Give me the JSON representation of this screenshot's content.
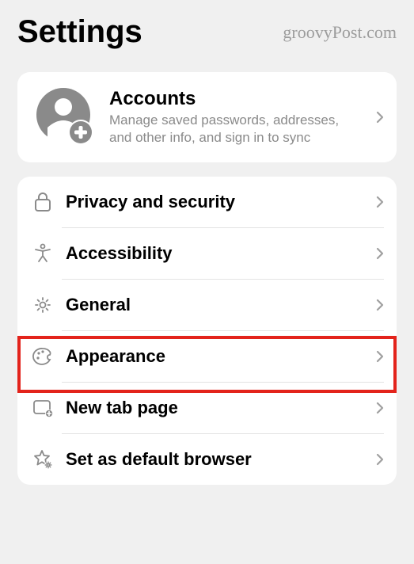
{
  "header": {
    "title": "Settings",
    "watermark": "groovyPost.com"
  },
  "account": {
    "title": "Accounts",
    "subtitle": "Manage saved passwords, addresses, and other info, and sign in to sync"
  },
  "items": [
    {
      "icon": "lock-icon",
      "label": "Privacy and security"
    },
    {
      "icon": "accessibility-icon",
      "label": "Accessibility"
    },
    {
      "icon": "gear-icon",
      "label": "General",
      "highlighted": true
    },
    {
      "icon": "palette-icon",
      "label": "Appearance"
    },
    {
      "icon": "newtab-icon",
      "label": "New tab page"
    },
    {
      "icon": "star-gear-icon",
      "label": "Set as default browser"
    }
  ]
}
